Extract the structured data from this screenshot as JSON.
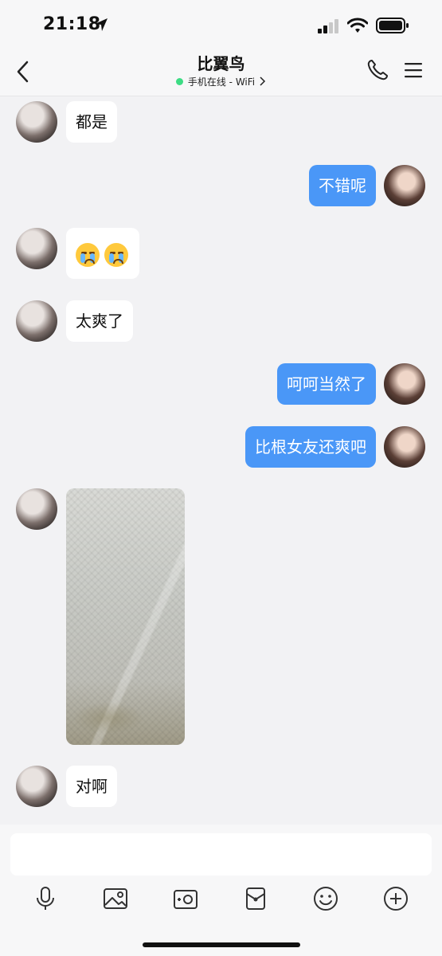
{
  "status_bar": {
    "time": "21:18",
    "icons": [
      "location-arrow-icon",
      "signal-icon",
      "wifi-icon",
      "battery-icon"
    ]
  },
  "header": {
    "title": "比翼鸟",
    "subtitle": "手机在线 - WiFi",
    "online_color": "#3ddc84",
    "icons": [
      "back-chevron-icon",
      "phone-icon",
      "menu-icon",
      "chevron-right-icon"
    ]
  },
  "messages": [
    {
      "side": "in",
      "type": "text",
      "text": "都是"
    },
    {
      "side": "out",
      "type": "text",
      "text": "不错呢"
    },
    {
      "side": "in",
      "type": "emoji",
      "emoji": [
        "crying-face-emoji",
        "crying-face-emoji"
      ]
    },
    {
      "side": "in",
      "type": "text",
      "text": "太爽了"
    },
    {
      "side": "out",
      "type": "text",
      "text": "呵呵当然了"
    },
    {
      "side": "out",
      "type": "text",
      "text": "比根女友还爽吧"
    },
    {
      "side": "in",
      "type": "image"
    },
    {
      "side": "in",
      "type": "text",
      "text": "对啊"
    }
  ],
  "colors": {
    "outgoing_bubble": "#4a97f7",
    "incoming_bubble": "#ffffff",
    "background": "#f2f2f4"
  },
  "toolbar": {
    "icons": [
      "microphone-icon",
      "photo-icon",
      "camera-icon",
      "red-packet-icon",
      "emoji-icon",
      "plus-icon"
    ]
  }
}
